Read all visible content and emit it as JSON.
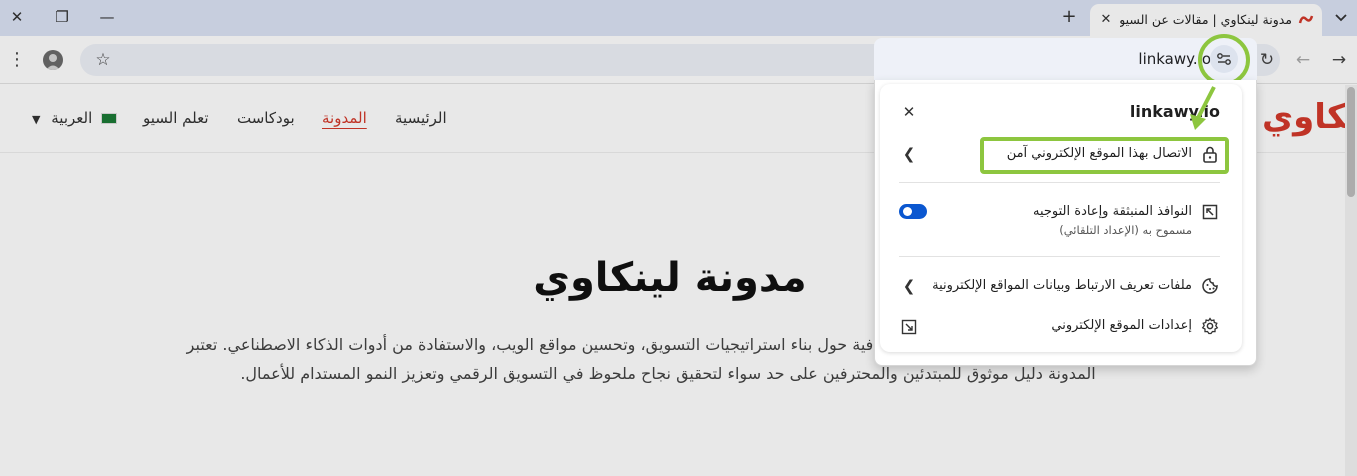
{
  "browser": {
    "tab": {
      "title": "مدونة لينكاوي | مقالات عن السيو..."
    },
    "window": {
      "close_glyph": "✕",
      "restore_glyph": "❐",
      "minimize_glyph": "—"
    },
    "omnibox": {
      "url": "linkawy.io/blog/"
    },
    "accent_color": "#8dc63f"
  },
  "site": {
    "logo_text": "لينكاوي",
    "nav": [
      {
        "label": "الرئيسية",
        "active": false
      },
      {
        "label": "المدونة",
        "active": true
      },
      {
        "label": "بودكاست",
        "active": false
      },
      {
        "label": "تعلم السيو",
        "active": false
      }
    ],
    "language": "العربية",
    "hero": {
      "title": "مدونة لينكاوي",
      "description": "…ت تعليمية، ودروسًا عملية، ونصائح احترافية حول بناء استراتيجيات التسويق، وتحسين مواقع الويب، والاستفادة من أدوات الذكاء الاصطناعي. تعتبر المدونة دليل موثوق للمبتدئين والمحترفين على حد سواء لتحقيق نجاح ملحوظ في التسويق الرقمي وتعزيز النمو المستدام للأعمال."
    },
    "brand_color": "#d3392a"
  },
  "site_info_popup": {
    "domain": "linkawy.io",
    "connection_label": "الاتصال بهذا الموقع الإلكتروني آمن",
    "popups": {
      "label": "النوافذ المنبثقة وإعادة التوجيه",
      "sublabel": "مسموح به (الإعداد التلقائي)",
      "enabled": true
    },
    "cookies_label": "ملفات تعريف الارتباط وبيانات المواقع الإلكترونية",
    "site_settings_label": "إعدادات الموقع الإلكتروني",
    "toggle_color": "#0b57d0"
  }
}
